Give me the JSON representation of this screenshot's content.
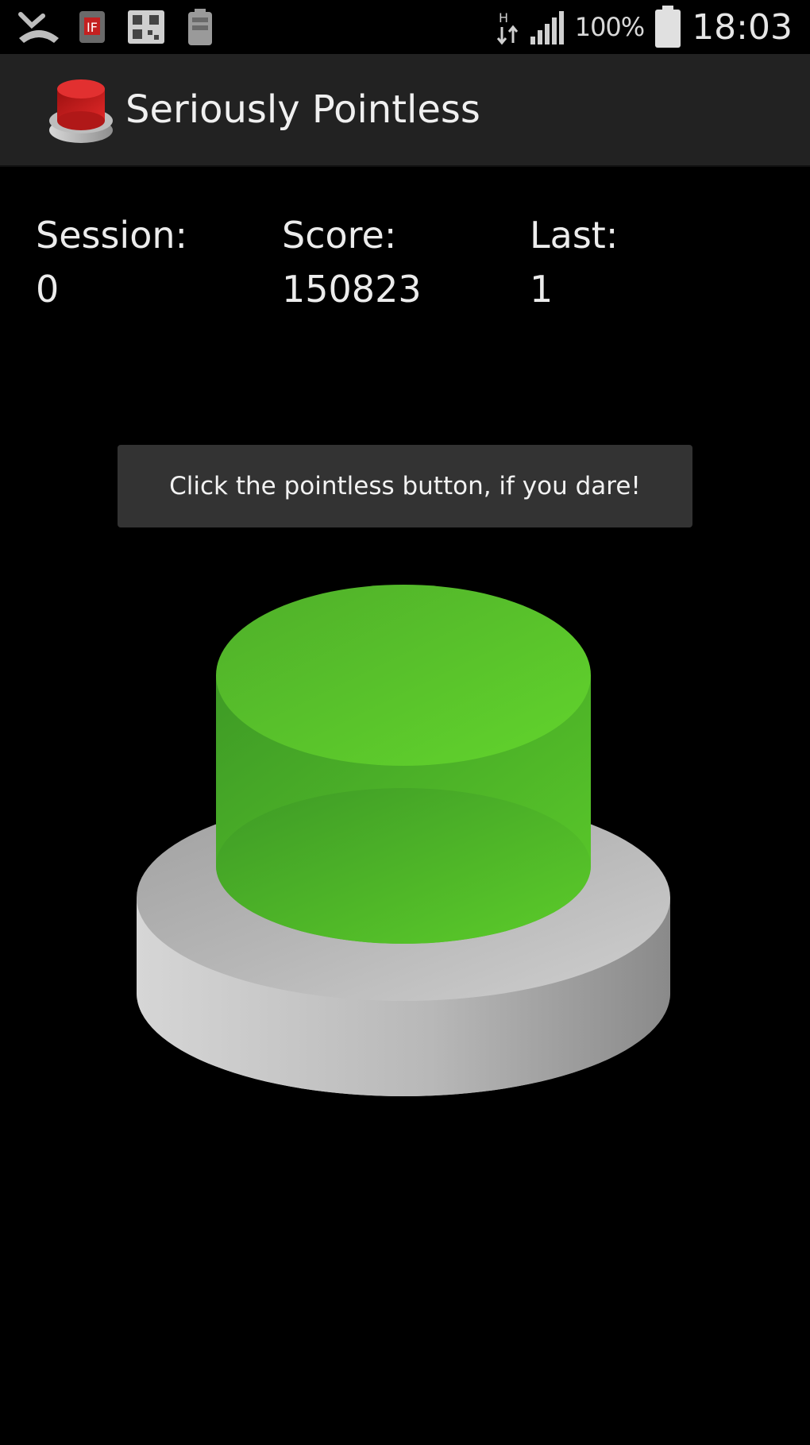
{
  "status_bar": {
    "battery_percent": "100%",
    "time": "18:03"
  },
  "action_bar": {
    "title": "Seriously Pointless"
  },
  "stats": {
    "session_label": "Session:",
    "session_value": "0",
    "score_label": "Score:",
    "score_value": "150823",
    "last_label": "Last:",
    "last_value": "1"
  },
  "hint_text": "Click the pointless button, if you dare!",
  "colors": {
    "button_top": "#5ccc2a",
    "button_base": "#bdbdbd",
    "app_icon_red": "#d01c1c",
    "action_bar_bg": "#222222"
  },
  "icons": {
    "status_left": [
      "missed-call-icon",
      "flash-card-icon",
      "sim-card-icon",
      "battery-saver-icon"
    ],
    "status_right": [
      "data-arrows-icon",
      "signal-icon",
      "battery-icon"
    ],
    "app": "red-button-app-icon"
  }
}
